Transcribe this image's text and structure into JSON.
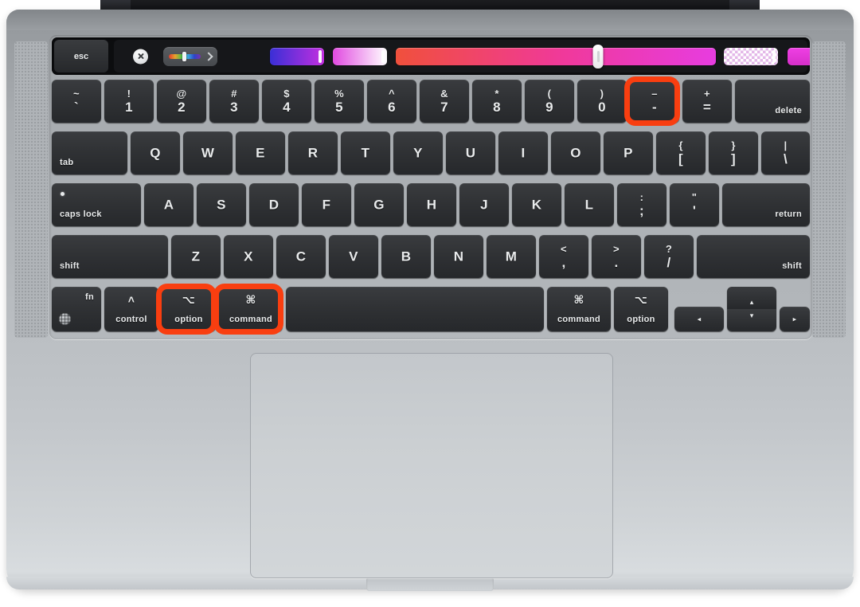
{
  "device": {
    "name": "MacBook Pro",
    "finish_color": "#b5b9bd",
    "key_color": "#303235",
    "highlight_color": "#f93e10"
  },
  "touch_bar": {
    "esc_label": "esc",
    "close_icon": "close-circle-icon",
    "color_picker_icon": "color-spectrum-icon",
    "expand_chevron": "chevron-right-icon",
    "segments": [
      {
        "name": "blue-purple-swatch",
        "gradient": "linear-gradient(90deg,#3a2fd6,#c32fe0)"
      },
      {
        "name": "magenta-white-swatch",
        "gradient": "linear-gradient(90deg,#e14ae0,#ffffff)"
      },
      {
        "name": "red-magenta-slider",
        "gradient": "linear-gradient(90deg,#f0503c,#f0399a,#e73ce0)"
      },
      {
        "name": "checker-transparency-swatch",
        "gradient": ""
      },
      {
        "name": "magenta-solid-swatch",
        "gradient": "linear-gradient(180deg,#ef3fe4,#d62fc9)"
      }
    ]
  },
  "highlighted_keys": [
    "minus",
    "option-left",
    "command-left"
  ],
  "keyboard": {
    "rows": [
      {
        "id": "number-row",
        "keys": [
          {
            "name": "tilde-grave",
            "top": "~",
            "bottom": "`"
          },
          {
            "name": "one",
            "top": "!",
            "bottom": "1"
          },
          {
            "name": "two",
            "top": "@",
            "bottom": "2"
          },
          {
            "name": "three",
            "top": "#",
            "bottom": "3"
          },
          {
            "name": "four",
            "top": "$",
            "bottom": "4"
          },
          {
            "name": "five",
            "top": "%",
            "bottom": "5"
          },
          {
            "name": "six",
            "top": "^",
            "bottom": "6"
          },
          {
            "name": "seven",
            "top": "&",
            "bottom": "7"
          },
          {
            "name": "eight",
            "top": "*",
            "bottom": "8"
          },
          {
            "name": "nine",
            "top": "(",
            "bottom": "9"
          },
          {
            "name": "zero",
            "top": ")",
            "bottom": "0"
          },
          {
            "name": "minus",
            "top": "–",
            "bottom": "-"
          },
          {
            "name": "equals",
            "top": "+",
            "bottom": "="
          },
          {
            "name": "delete",
            "word": "delete"
          }
        ]
      },
      {
        "id": "tab-row",
        "keys": [
          {
            "name": "tab",
            "word": "tab"
          },
          {
            "name": "q",
            "alpha": "Q"
          },
          {
            "name": "w",
            "alpha": "W"
          },
          {
            "name": "e",
            "alpha": "E"
          },
          {
            "name": "r",
            "alpha": "R"
          },
          {
            "name": "t",
            "alpha": "T"
          },
          {
            "name": "y",
            "alpha": "Y"
          },
          {
            "name": "u",
            "alpha": "U"
          },
          {
            "name": "i",
            "alpha": "I"
          },
          {
            "name": "o",
            "alpha": "O"
          },
          {
            "name": "p",
            "alpha": "P"
          },
          {
            "name": "bracket-left",
            "top": "{",
            "bottom": "["
          },
          {
            "name": "bracket-right",
            "top": "}",
            "bottom": "]"
          },
          {
            "name": "backslash",
            "top": "|",
            "bottom": "\\"
          }
        ]
      },
      {
        "id": "home-row",
        "keys": [
          {
            "name": "caps-lock",
            "word": "caps lock"
          },
          {
            "name": "a",
            "alpha": "A"
          },
          {
            "name": "s",
            "alpha": "S"
          },
          {
            "name": "d",
            "alpha": "D"
          },
          {
            "name": "f",
            "alpha": "F"
          },
          {
            "name": "g",
            "alpha": "G"
          },
          {
            "name": "h",
            "alpha": "H"
          },
          {
            "name": "j",
            "alpha": "J"
          },
          {
            "name": "k",
            "alpha": "K"
          },
          {
            "name": "l",
            "alpha": "L"
          },
          {
            "name": "semicolon",
            "top": ":",
            "bottom": ";"
          },
          {
            "name": "quote",
            "top": "\"",
            "bottom": "'"
          },
          {
            "name": "return",
            "word": "return"
          }
        ]
      },
      {
        "id": "shift-row",
        "keys": [
          {
            "name": "shift-left",
            "word": "shift"
          },
          {
            "name": "z",
            "alpha": "Z"
          },
          {
            "name": "x",
            "alpha": "X"
          },
          {
            "name": "c",
            "alpha": "C"
          },
          {
            "name": "v",
            "alpha": "V"
          },
          {
            "name": "b",
            "alpha": "B"
          },
          {
            "name": "n",
            "alpha": "N"
          },
          {
            "name": "m",
            "alpha": "M"
          },
          {
            "name": "comma",
            "top": "<",
            "bottom": ","
          },
          {
            "name": "period",
            "top": ">",
            "bottom": "."
          },
          {
            "name": "slash",
            "top": "?",
            "bottom": "/"
          },
          {
            "name": "shift-right",
            "word": "shift"
          }
        ]
      },
      {
        "id": "modifier-row",
        "keys": [
          {
            "name": "fn",
            "word": "fn",
            "glyph": "globe-icon"
          },
          {
            "name": "control",
            "word": "control",
            "glyph": "˄"
          },
          {
            "name": "option-left",
            "word": "option",
            "glyph": "⌥"
          },
          {
            "name": "command-left",
            "word": "command",
            "glyph": "⌘"
          },
          {
            "name": "space",
            "word": ""
          },
          {
            "name": "command-right",
            "word": "command",
            "glyph": "⌘"
          },
          {
            "name": "option-right",
            "word": "option",
            "glyph": "⌥"
          },
          {
            "name": "arrow-left",
            "glyph": "◂"
          },
          {
            "name": "arrow-up",
            "glyph": "▴"
          },
          {
            "name": "arrow-down",
            "glyph": "▾"
          },
          {
            "name": "arrow-right",
            "glyph": "▸"
          }
        ]
      }
    ]
  },
  "trackpad": {
    "name": "trackpad"
  }
}
